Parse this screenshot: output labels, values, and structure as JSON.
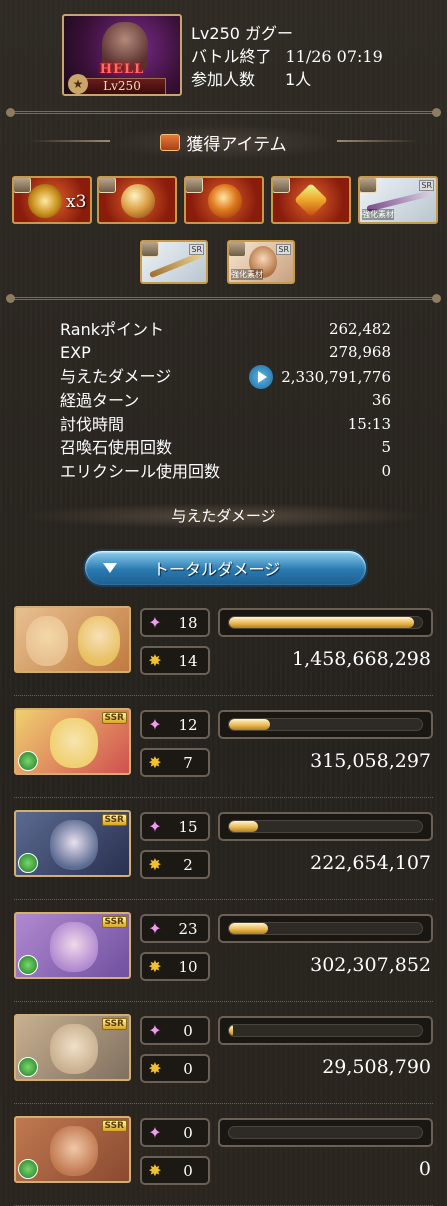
{
  "quest": {
    "banner_tag": "HELL",
    "banner_level": "Lv250",
    "title": "Lv250 ガグー",
    "battle_end_label": "バトル終了",
    "battle_end_time": "11/26 07:19",
    "participants_label": "参加人数",
    "participants": "1人"
  },
  "items_title": "獲得アイテム",
  "items": [
    {
      "name": "gold-emblem",
      "count": "x3"
    },
    {
      "name": "orb-1"
    },
    {
      "name": "orb-2"
    },
    {
      "name": "crystal"
    },
    {
      "name": "weapon-bow",
      "rarity": "SR",
      "tag": "強化素材"
    },
    {
      "name": "weapon-staff",
      "rarity": "SR"
    },
    {
      "name": "character-sr",
      "rarity": "SR",
      "tag": "強化素材"
    }
  ],
  "stats": [
    {
      "label": "Rankポイント",
      "value": "262,482"
    },
    {
      "label": "EXP",
      "value": "278,968"
    },
    {
      "label": "与えたダメージ",
      "value": "2,330,791,776"
    },
    {
      "label": "経過ターン",
      "value": "36"
    },
    {
      "label": "討伐時間",
      "value": "15:13"
    },
    {
      "label": "召喚石使用回数",
      "value": "5"
    },
    {
      "label": "エリクシール使用回数",
      "value": "0"
    }
  ],
  "damage_title": "与えたダメージ",
  "total_damage_button": "トータルダメージ",
  "characters": [
    {
      "name": "main-character",
      "element": "",
      "skills": "18",
      "ougi": "14",
      "damage": "1,458,668,298",
      "share": 0.96
    },
    {
      "name": "character-2",
      "element": "wind",
      "rarity": "SSR",
      "skills": "12",
      "ougi": "7",
      "damage": "315,058,297",
      "share": 0.21
    },
    {
      "name": "character-3",
      "element": "wind",
      "rarity": "SSR",
      "skills": "15",
      "ougi": "2",
      "damage": "222,654,107",
      "share": 0.15
    },
    {
      "name": "character-4",
      "element": "wind",
      "rarity": "SSR",
      "skills": "23",
      "ougi": "10",
      "damage": "302,307,852",
      "share": 0.2
    },
    {
      "name": "character-5",
      "element": "wind",
      "rarity": "SSR",
      "skills": "0",
      "ougi": "0",
      "damage": "29,508,790",
      "share": 0.02
    },
    {
      "name": "character-6",
      "element": "wind",
      "rarity": "SSR",
      "skills": "0",
      "ougi": "0",
      "damage": "0",
      "share": 0
    }
  ]
}
